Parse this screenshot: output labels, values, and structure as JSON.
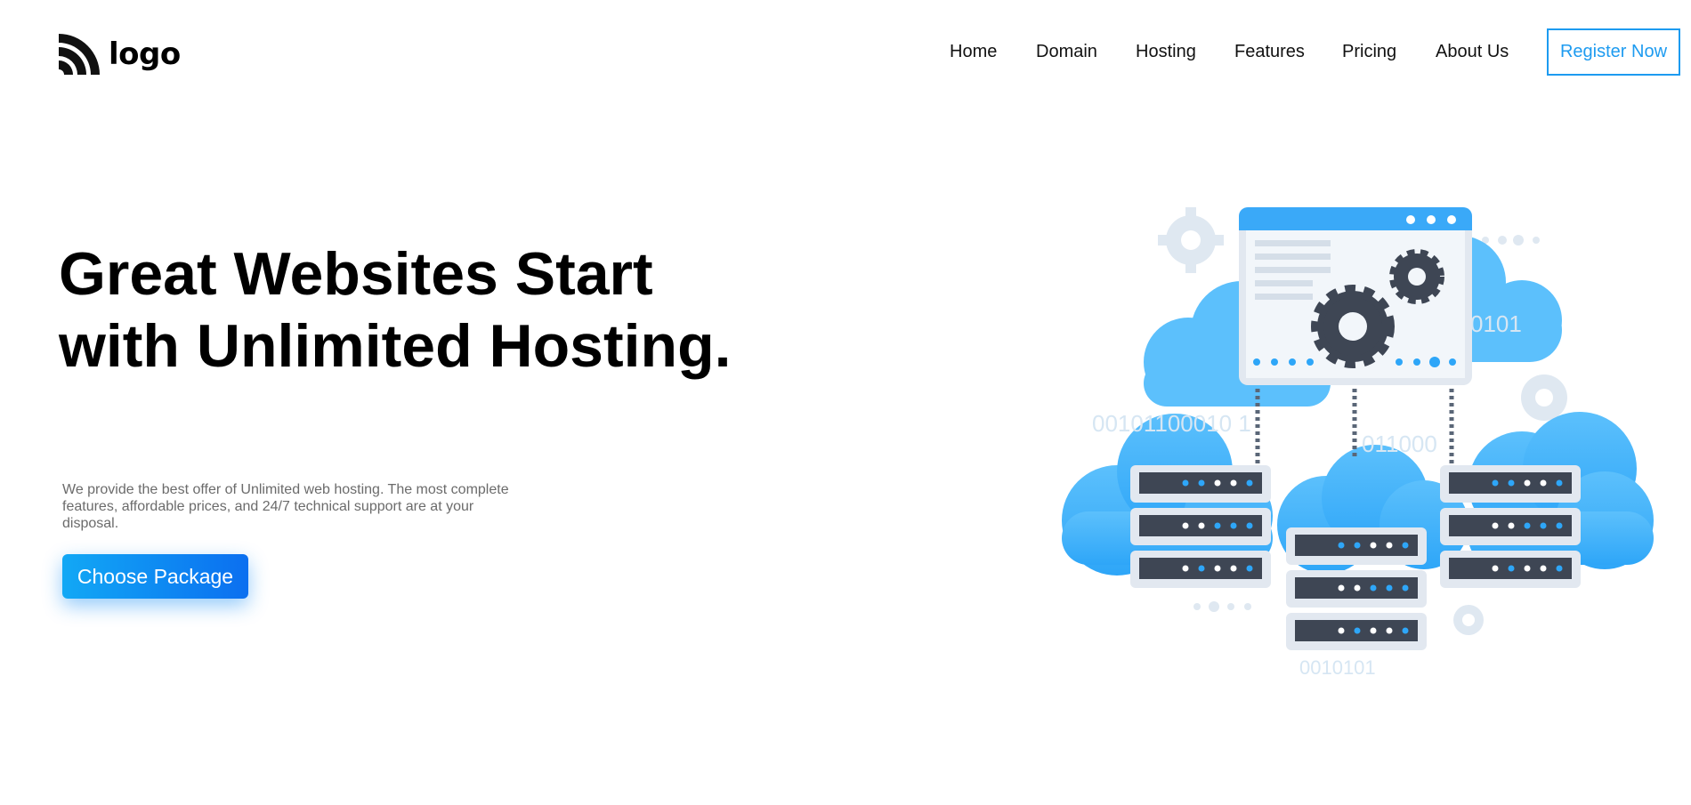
{
  "brand": {
    "logo_text": "logo"
  },
  "nav": {
    "items": [
      {
        "label": "Home"
      },
      {
        "label": "Domain"
      },
      {
        "label": "Hosting"
      },
      {
        "label": "Features"
      },
      {
        "label": "Pricing"
      },
      {
        "label": "About Us"
      }
    ],
    "register_label": "Register Now"
  },
  "hero": {
    "title": "Great Websites Start with Unlimited Hosting.",
    "description": "We provide the best offer of Unlimited web hosting. The most complete features, affordable prices, and 24/7 technical support are at your disposal.",
    "cta_label": "Choose Package"
  },
  "illustration": {
    "binary_1": "0101",
    "binary_2": "00101100010 1",
    "binary_3": "011000",
    "binary_4": "0010101"
  },
  "colors": {
    "accent": "#1d9bf0",
    "cta_start": "#12a8f5",
    "cta_end": "#0b6ff0",
    "cloud": "#3fb2fb",
    "server_dark": "#3e4654",
    "server_light": "#e2e8f0"
  }
}
